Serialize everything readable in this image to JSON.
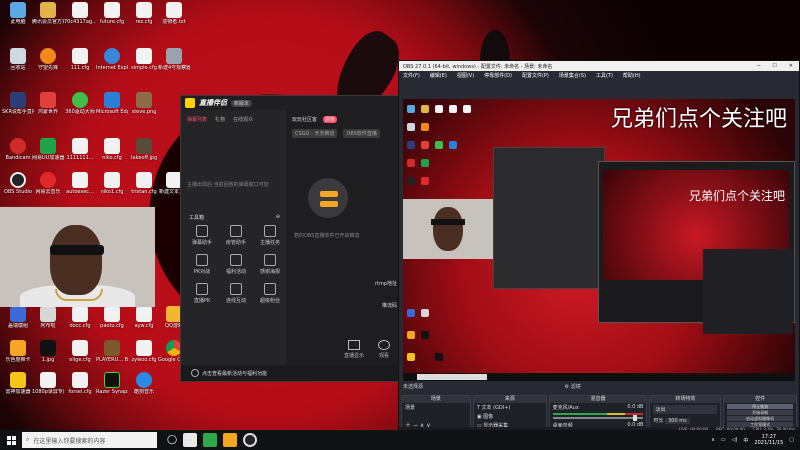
{
  "desktop": {
    "icons_col1": [
      "此电脑",
      "回收站",
      "SKR说帮手直播",
      "Bandicam",
      "OBS Studio"
    ],
    "icons_col2": [
      "腾讯会员官方充值平台",
      "守望先锋",
      "鸿蒙世界",
      "网易UU加速器",
      "网易云音乐"
    ],
    "icons_col3": [
      "70c4317ag...",
      "111.cfg",
      "360驱动大师",
      "1111111...",
      "autoexec..."
    ],
    "icons_col4": [
      "future.cfg",
      "Internet Explorer",
      "Microsoft Edge",
      "niko.cfg",
      "niko1.cfg"
    ],
    "icons_col5": [
      "rez.cfg",
      "simple.cfg",
      "steve.png",
      "takeoff.jpg",
      "tristan.cfg"
    ],
    "icons_col6": [
      "造物者.txt",
      "新建4号观察器",
      "",
      "",
      "新建文本文档"
    ],
    "bottom_row1": [
      "盖瑞模组",
      "阿布啦",
      "docc.cfg",
      "paotu.cfg",
      "ayw.cfg",
      "QQ游戏"
    ],
    "bottom_row2": [
      "乐色度推卡",
      "1.jpg",
      "elige.cfg",
      "PLAYERU... BATTLEGR...",
      "zywoo.cfg",
      "Google Chrome"
    ],
    "bottom_row3": [
      "雷神加速器",
      "1080p录屏专用1080p",
      "forsel.cfg",
      "Razer Synapse",
      "酷狗音乐"
    ]
  },
  "helper": {
    "brand": "直播伴侣",
    "version": "新版本",
    "left_tabs": [
      "弹幕列表",
      "礼物",
      "在线观众"
    ],
    "hint": "主播出现后 当前回放的弹幕窗口可加",
    "toolbox_label": "工具箱",
    "tools": [
      "弹幕助手",
      "房管助手",
      "主播任务",
      "PK对战",
      "福利活动",
      "感谢海报",
      "直播PK",
      "连线互动",
      "超级粉丝"
    ],
    "right_tabs": [
      "玩玩社区客",
      "摄像"
    ],
    "badge": "",
    "source_select": "OBS软件直播",
    "label_cs": "CSGO - 天天推流",
    "obs_hint": "若的OBS直播软件已开启推流",
    "rtmp_label": "rtmp地址",
    "push_code_label": "推流码",
    "bottom_left": "直播显示",
    "bottom_right": "观看",
    "footer_text": "点击查看最新活动与福利功能"
  },
  "obs": {
    "title": "OBS 27.0.1 (64-bit, windows) - 配置文件: 未命名 - 场景: 未命名",
    "menu": [
      "文件(F)",
      "编辑(E)",
      "视图(V)",
      "停靠部件(D)",
      "配置文件(P)",
      "场景集合(S)",
      "工具(T)",
      "帮助(H)"
    ],
    "caption_big": "兄弟们点个关注吧",
    "caption_small": "兄弟们点个关注吧",
    "scene_bar_label": "未选择源",
    "scene_bar_right": "滤镜",
    "docks": {
      "scenes_header": "场景",
      "scenes": [
        "场景"
      ],
      "sources_header": "来源",
      "sources": [
        "文本 (GDI+)",
        "图像",
        "显示器采集"
      ],
      "mixer_header": "混音器",
      "mixer_tracks": [
        {
          "name": "麦克风/Aux",
          "db": "0.0 dB"
        },
        {
          "name": "桌面音频",
          "db": "0.0 dB"
        }
      ],
      "transitions_header": "转场特效",
      "transition_type": "淡出",
      "duration_label": "时长",
      "duration_value": "300 ms",
      "controls_header": "控件",
      "controls": [
        "停止推流",
        "开始录制",
        "启动虚拟摄像机",
        "工作室模式",
        "设置",
        "退出"
      ]
    },
    "status": {
      "live": "LIVE: 00:00:00",
      "rec": "REC: 00:00:00",
      "cpu": "CPU: 3.4%, 30.00 fps"
    }
  },
  "taskbar": {
    "search_placeholder": "在这里输入你要搜索的内容",
    "time": "17:27",
    "date": "2021/11/15"
  }
}
